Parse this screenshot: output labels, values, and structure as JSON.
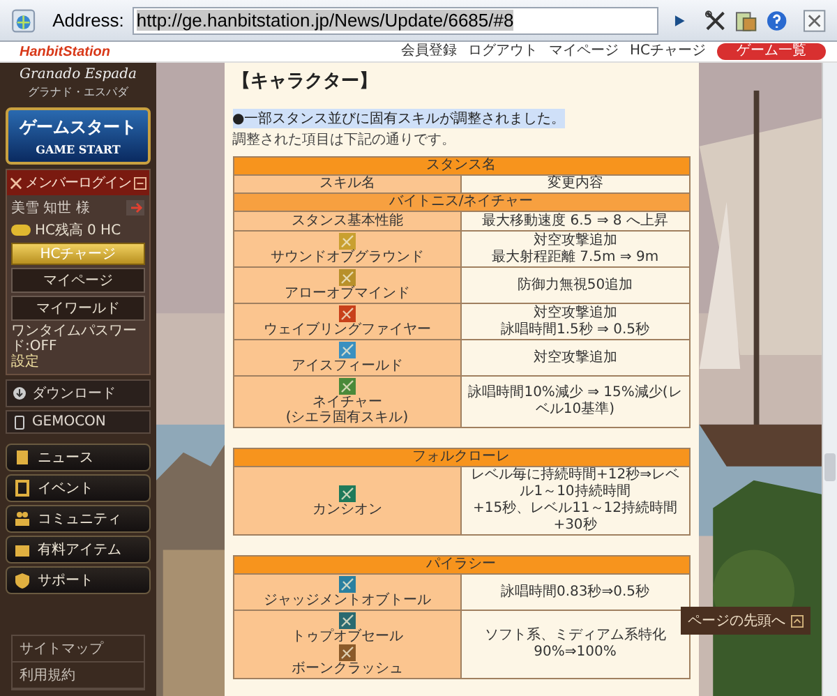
{
  "browser": {
    "address_label": "Address:",
    "url": "http://ge.hanbitstation.jp/News/Update/6685/#8",
    "url_selected": true
  },
  "site_header": {
    "logo": "HanbitStation",
    "links": [
      "会員登録",
      "ログアウト",
      "マイページ",
      "HCチャージ"
    ],
    "game_button": "ゲーム一覧"
  },
  "sidebar": {
    "logo": "Granado Espada",
    "logo_sub": "グラナド・エスパダ",
    "start_button": {
      "label": "ゲームスタート",
      "sub": "GAME START"
    },
    "login": {
      "title": "メンバーログイン",
      "user": "美雪 知世 様",
      "hc_label": "HC残高",
      "hc_value": "0 HC",
      "charge": "HCチャージ",
      "buttons": [
        "マイページ",
        "マイワールド"
      ],
      "otp": "ワンタイムパスワード:OFF",
      "otp_link": "設定"
    },
    "downloads": [
      "ダウンロード",
      "GEMOCON"
    ],
    "nav": [
      "ニュース",
      "イベント",
      "コミュニティ",
      "有料アイテム",
      "サポート"
    ],
    "footer_links": [
      "サイトマップ",
      "利用規約"
    ]
  },
  "content": {
    "heading": "【キャラクター】",
    "lead": "●一部スタンス並びに固有スキルが調整されました。",
    "lead_highlighted": true,
    "note": "調整された項目は下記の通りです。",
    "tables": [
      {
        "title": "スタンス名",
        "columns": [
          "スキル名",
          "変更内容"
        ],
        "subtitle": "バイトニス/ネイチャー",
        "rows": [
          {
            "skills": [
              {
                "name": "スタンス基本性能"
              }
            ],
            "change": [
              "最大移動速度 6.5 ⇒ 8 へ上昇"
            ]
          },
          {
            "skills": [
              {
                "name": "サウンドオブグラウンド",
                "color": "#c9a030"
              }
            ],
            "change": [
              "対空攻撃追加",
              "最大射程距離 7.5m ⇒ 9m"
            ]
          },
          {
            "skills": [
              {
                "name": "アローオブマインド",
                "color": "#b8902a"
              }
            ],
            "change": [
              "防御力無視50追加"
            ]
          },
          {
            "skills": [
              {
                "name": "ウェイブリングファイヤー",
                "color": "#c8401a"
              }
            ],
            "change": [
              "対空攻撃追加",
              "詠唱時間1.5秒 ⇒ 0.5秒"
            ]
          },
          {
            "skills": [
              {
                "name": "アイスフィールド",
                "color": "#3a90c0"
              }
            ],
            "change": [
              "対空攻撃追加"
            ]
          },
          {
            "skills": [
              {
                "name": "ネイチャー\n(シエラ固有スキル)",
                "color": "#4a8a3a"
              }
            ],
            "change": [
              "詠唱時間10%減少 ⇒ 15%減少(レベル10基準)"
            ]
          }
        ]
      },
      {
        "title": "フォルクローレ",
        "rows": [
          {
            "skills": [
              {
                "name": "カンシオン",
                "color": "#1f7a5a"
              }
            ],
            "change": [
              "レベル毎に持続時間+12秒⇒レベル1～10持続時間",
              "+15秒、レベル11～12持続時間+30秒"
            ]
          }
        ]
      },
      {
        "title": "パイラシー",
        "rows": [
          {
            "skills": [
              {
                "name": "ジャッジメントオブトール",
                "color": "#2a80a0"
              }
            ],
            "change": [
              "詠唱時間0.83秒⇒0.5秒"
            ]
          },
          {
            "skills": [
              {
                "name": "トゥプオブセール",
                "color": "#2a6a70"
              },
              {
                "name": "ボーンクラッシュ",
                "color": "#8a5a2a"
              }
            ],
            "change": [
              "ソフト系、ミディアム系特化90%⇒100%"
            ]
          }
        ]
      }
    ]
  },
  "page_top": "ページの先頭へ"
}
